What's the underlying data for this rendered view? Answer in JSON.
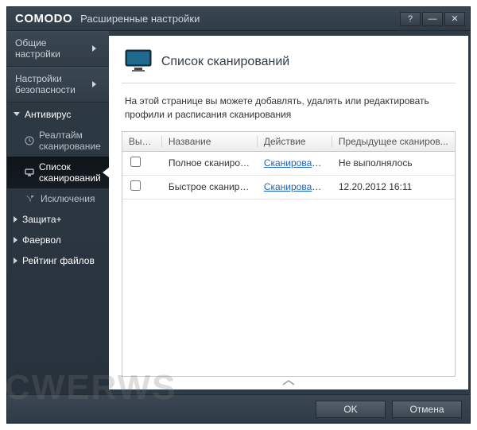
{
  "titlebar": {
    "brand": "COMODO",
    "title": "Расширенные настройки",
    "help": "?",
    "minimize": "—",
    "close": "✕"
  },
  "sidebar": {
    "sections": [
      {
        "label": "Общие настройки"
      },
      {
        "label": "Настройки безопасности"
      }
    ],
    "groups": [
      {
        "label": "Антивирус",
        "expanded": true,
        "items": [
          {
            "label": "Реалтайм сканирование",
            "icon": "clock"
          },
          {
            "label": "Список сканирований",
            "icon": "monitor",
            "active": true
          },
          {
            "label": "Исключения",
            "icon": "funnel"
          }
        ]
      },
      {
        "label": "Защита+",
        "expanded": false,
        "items": []
      },
      {
        "label": "Фаервол",
        "expanded": false,
        "items": []
      },
      {
        "label": "Рейтинг файлов",
        "expanded": false,
        "items": []
      }
    ]
  },
  "page": {
    "heading": "Список сканирований",
    "description": "На этой странице вы можете добавлять, удалять или редактировать профили и расписания сканирования"
  },
  "table": {
    "columns": {
      "select": "Выбр...",
      "name": "Название",
      "action": "Действие",
      "previous": "Предыдущее сканиров..."
    },
    "rows": [
      {
        "selected": false,
        "name": "Полное сканиров...",
        "action": "Сканирование",
        "prev": "Не выполнялось"
      },
      {
        "selected": false,
        "name": "Быстрое сканиро...",
        "action": "Сканирование",
        "prev": "12.20.2012 16:11"
      }
    ]
  },
  "footer": {
    "ok": "OK",
    "cancel": "Отмена"
  },
  "watermark": "CWERWS"
}
